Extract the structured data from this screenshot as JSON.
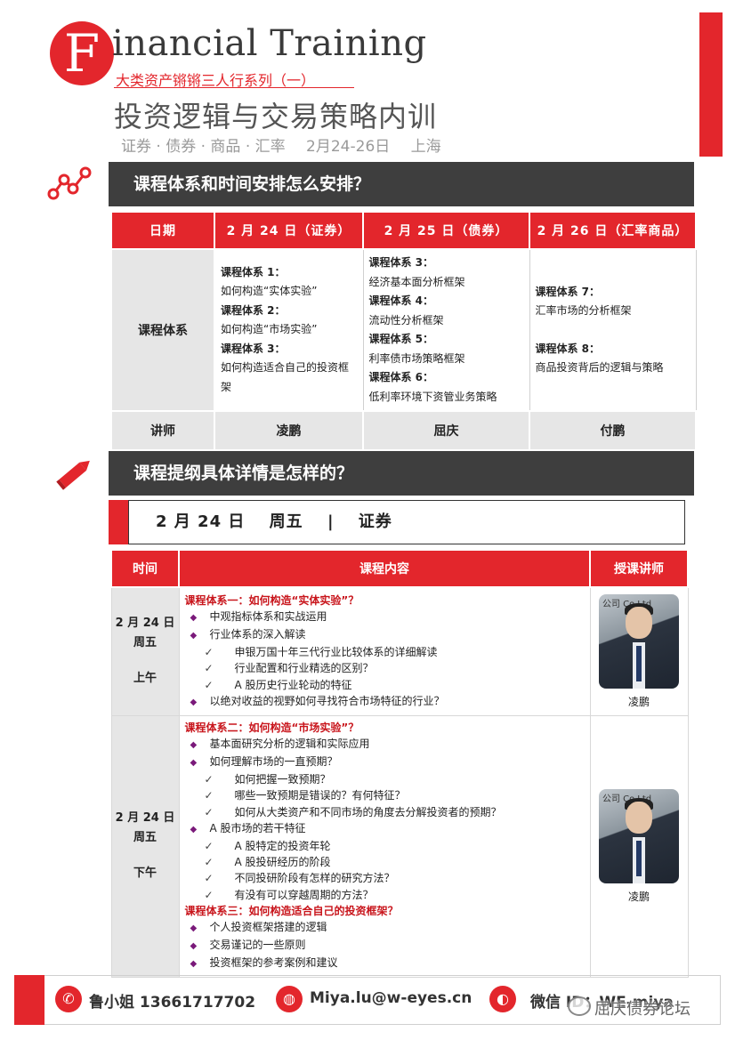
{
  "header": {
    "logo_letter": "F",
    "title_en": "inancial Training",
    "subtitle": "大类资产锵锵三人行系列（一）",
    "title_cn": "投资逻辑与交易策略内训",
    "meta_topics": "证券 · 债券 · 商品 · 汇率",
    "meta_date": "2月24-26日",
    "meta_city": "上海"
  },
  "colors": {
    "accent": "#e3262c",
    "dark": "#3e3e3e",
    "gray": "#e6e6e6"
  },
  "section1": {
    "icon": "line-chart-icon",
    "title": "课程体系和时间安排怎么安排？",
    "headers": [
      "日期",
      "2 月 24 日（证券）",
      "2 月 25 日（债券）",
      "2 月 26 日（汇率商品）"
    ],
    "row_label": "课程体系",
    "day1": [
      {
        "title": "课程体系 1：",
        "desc": "如何构造“实体实验”"
      },
      {
        "title": "课程体系 2：",
        "desc": "如何构造“市场实验”"
      },
      {
        "title": "课程体系 3：",
        "desc": "如何构造适合自己的投资框",
        "desc2": "架"
      }
    ],
    "day2": [
      {
        "title": "课程体系 3：",
        "desc": "经济基本面分析框架"
      },
      {
        "title": "课程体系 4：",
        "desc": "流动性分析框架"
      },
      {
        "title": "课程体系 5：",
        "desc": "利率债市场策略框架"
      },
      {
        "title": "课程体系 6：",
        "desc": "低利率环境下资管业务策略"
      }
    ],
    "day3": [
      {
        "title": "课程体系 7：",
        "desc": "汇率市场的分析框架"
      },
      {
        "title": "课程体系 8：",
        "desc": "商品投资背后的逻辑与策略"
      }
    ],
    "teacher_label": "讲师",
    "teachers": [
      "凌鹏",
      "屈庆",
      "付鹏"
    ]
  },
  "section2": {
    "icon": "pencil-icon",
    "title": "课程提纲具体详情是怎样的？",
    "date_band": {
      "date": "2 月 24 日",
      "weekday": "周五",
      "sep": "|",
      "topic": "证券"
    },
    "headers": [
      "时间",
      "课程内容",
      "授课讲师"
    ],
    "morning": {
      "date": "2 月 24 日",
      "weekday": "周五",
      "period": "上午",
      "teacher": "凌鹏",
      "photo_watermark": "公司 Co.Ltd",
      "lines": [
        {
          "t": "h",
          "text": "课程体系一：如何构造“实体实验”？"
        },
        {
          "t": "b",
          "text": "中观指标体系和实战运用"
        },
        {
          "t": "b",
          "text": "行业体系的深入解读"
        },
        {
          "t": "c",
          "text": "申银万国十年三代行业比较体系的详细解读"
        },
        {
          "t": "c",
          "text": "行业配置和行业精选的区别？"
        },
        {
          "t": "c",
          "text": "A 股历史行业轮动的特征"
        },
        {
          "t": "b",
          "text": "以绝对收益的视野如何寻找符合市场特征的行业？"
        }
      ]
    },
    "afternoon": {
      "date": "2 月 24 日",
      "weekday": "周五",
      "period": "下午",
      "teacher": "凌鹏",
      "photo_watermark": "公司 Co.Ltd",
      "lines": [
        {
          "t": "h",
          "text": "课程体系二：如何构造“市场实验”？"
        },
        {
          "t": "b",
          "text": "基本面研究分析的逻辑和实际应用"
        },
        {
          "t": "b",
          "text": "如何理解市场的一直预期？"
        },
        {
          "t": "c",
          "text": "如何把握一致预期？"
        },
        {
          "t": "c",
          "text": "哪些一致预期是错误的？有何特征？"
        },
        {
          "t": "c",
          "text": "如何从大类资产和不同市场的角度去分解投资者的预期？"
        },
        {
          "t": "b",
          "text": "A 股市场的若干特征"
        },
        {
          "t": "c",
          "text": "A 股特定的投资年轮"
        },
        {
          "t": "c",
          "text": "A 股投研经历的阶段"
        },
        {
          "t": "c",
          "text": "不同投研阶段有怎样的研究方法？"
        },
        {
          "t": "c",
          "text": "有没有可以穿越周期的方法？"
        },
        {
          "t": "h",
          "text": "课程体系三：如何构造适合自己的投资框架？"
        },
        {
          "t": "b",
          "text": "个人投资框架搭建的逻辑"
        },
        {
          "t": "b",
          "text": "交易谨记的一些原则"
        },
        {
          "t": "b",
          "text": "投资框架的参考案例和建议"
        }
      ]
    }
  },
  "footer": {
    "contact": "鲁小姐  13661717702",
    "email": "Miya.lu@w-eyes.cn",
    "wechat": "微信 ID：WE-miya",
    "watermark": "屈庆债券论坛"
  }
}
